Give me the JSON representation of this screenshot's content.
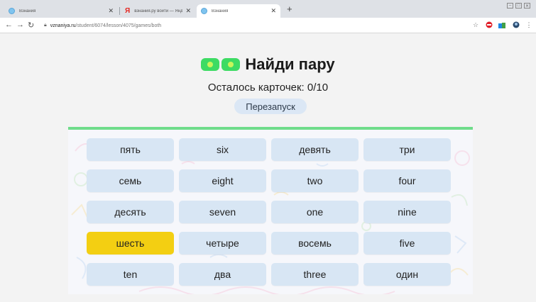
{
  "browser": {
    "tabs": [
      {
        "title": "Взнания",
        "active": false
      },
      {
        "title": "взнания.ру войти — Яндекс: нашл",
        "active": false
      },
      {
        "title": "Взнания",
        "active": true
      }
    ],
    "url_host": "vznaniya.ru",
    "url_path": "/student/6074/lesson/4075/games/both"
  },
  "page": {
    "title": "Найди пару",
    "counter": "Осталось карточек: 0/10",
    "restart_label": "Перезапуск"
  },
  "cards": [
    {
      "label": "пять",
      "selected": false
    },
    {
      "label": "six",
      "selected": false
    },
    {
      "label": "девять",
      "selected": false
    },
    {
      "label": "три",
      "selected": false
    },
    {
      "label": "семь",
      "selected": false
    },
    {
      "label": "eight",
      "selected": false
    },
    {
      "label": "two",
      "selected": false
    },
    {
      "label": "four",
      "selected": false
    },
    {
      "label": "десять",
      "selected": false
    },
    {
      "label": "seven",
      "selected": false
    },
    {
      "label": "one",
      "selected": false
    },
    {
      "label": "nine",
      "selected": false
    },
    {
      "label": "шесть",
      "selected": true
    },
    {
      "label": "четыре",
      "selected": false
    },
    {
      "label": "восемь",
      "selected": false
    },
    {
      "label": "five",
      "selected": false
    },
    {
      "label": "ten",
      "selected": false
    },
    {
      "label": "два",
      "selected": false
    },
    {
      "label": "three",
      "selected": false
    },
    {
      "label": "один",
      "selected": false
    }
  ],
  "colors": {
    "accent_green": "#3ddb63",
    "card": "#d8e6f4",
    "card_selected": "#f3cf12",
    "restart_bg": "#dbe7f5"
  }
}
